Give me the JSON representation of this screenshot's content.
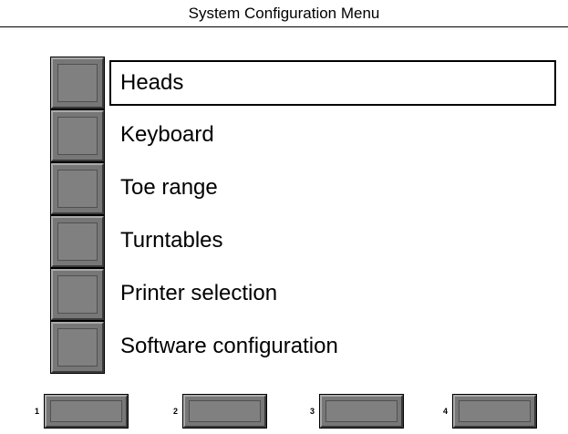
{
  "window": {
    "title": "System Configuration Menu"
  },
  "menu": {
    "selected_index": 0,
    "items": [
      {
        "label": "Heads"
      },
      {
        "label": "Keyboard"
      },
      {
        "label": "Toe range"
      },
      {
        "label": "Turntables"
      },
      {
        "label": "Printer selection"
      },
      {
        "label": "Software configuration"
      }
    ]
  },
  "function_keys": [
    {
      "number": "1",
      "label": ""
    },
    {
      "number": "2",
      "label": ""
    },
    {
      "number": "3",
      "label": ""
    },
    {
      "number": "4",
      "label": ""
    }
  ],
  "colors": {
    "background": "#ffffff",
    "key_face": "#808080",
    "key_highlight": "#aaaaaa",
    "key_shadow": "#3a3a3a",
    "text": "#000000"
  }
}
